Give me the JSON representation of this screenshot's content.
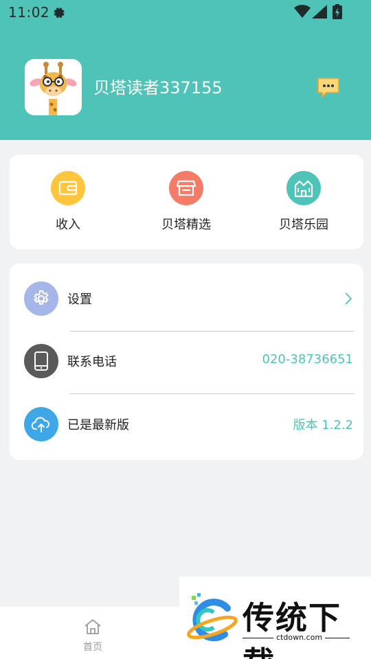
{
  "status_bar": {
    "time": "11:02",
    "icons": [
      "gear-icon",
      "wifi-icon",
      "signal-icon",
      "battery-icon"
    ]
  },
  "profile": {
    "username": "贝塔读者337155",
    "avatar": "giraffe-avatar",
    "message_icon": "message-icon"
  },
  "shortcuts": [
    {
      "label": "收入",
      "icon": "wallet-icon",
      "color": "#ffc53d"
    },
    {
      "label": "贝塔精选",
      "icon": "store-icon",
      "color": "#f47b67"
    },
    {
      "label": "贝塔乐园",
      "icon": "castle-icon",
      "color": "#4fc3b8"
    }
  ],
  "menu": [
    {
      "label": "设置",
      "value": "",
      "icon": "gear-icon",
      "color": "#a6b6e8",
      "trailing": "chevron-right-icon"
    },
    {
      "label": "联系电话",
      "value": "020-38736651",
      "icon": "phone-icon",
      "color": "#5a5a5a"
    },
    {
      "label": "已是最新版",
      "value": "版本 1.2.2",
      "icon": "cloud-upload-icon",
      "color": "#3da7e8"
    }
  ],
  "bottom_nav": {
    "home_label": "首页",
    "home_icon": "home-icon"
  },
  "watermark": {
    "text": "传统下载",
    "url": "ctdown.com"
  },
  "colors": {
    "accent": "#4fc3b8",
    "background": "#f1f2f4"
  }
}
